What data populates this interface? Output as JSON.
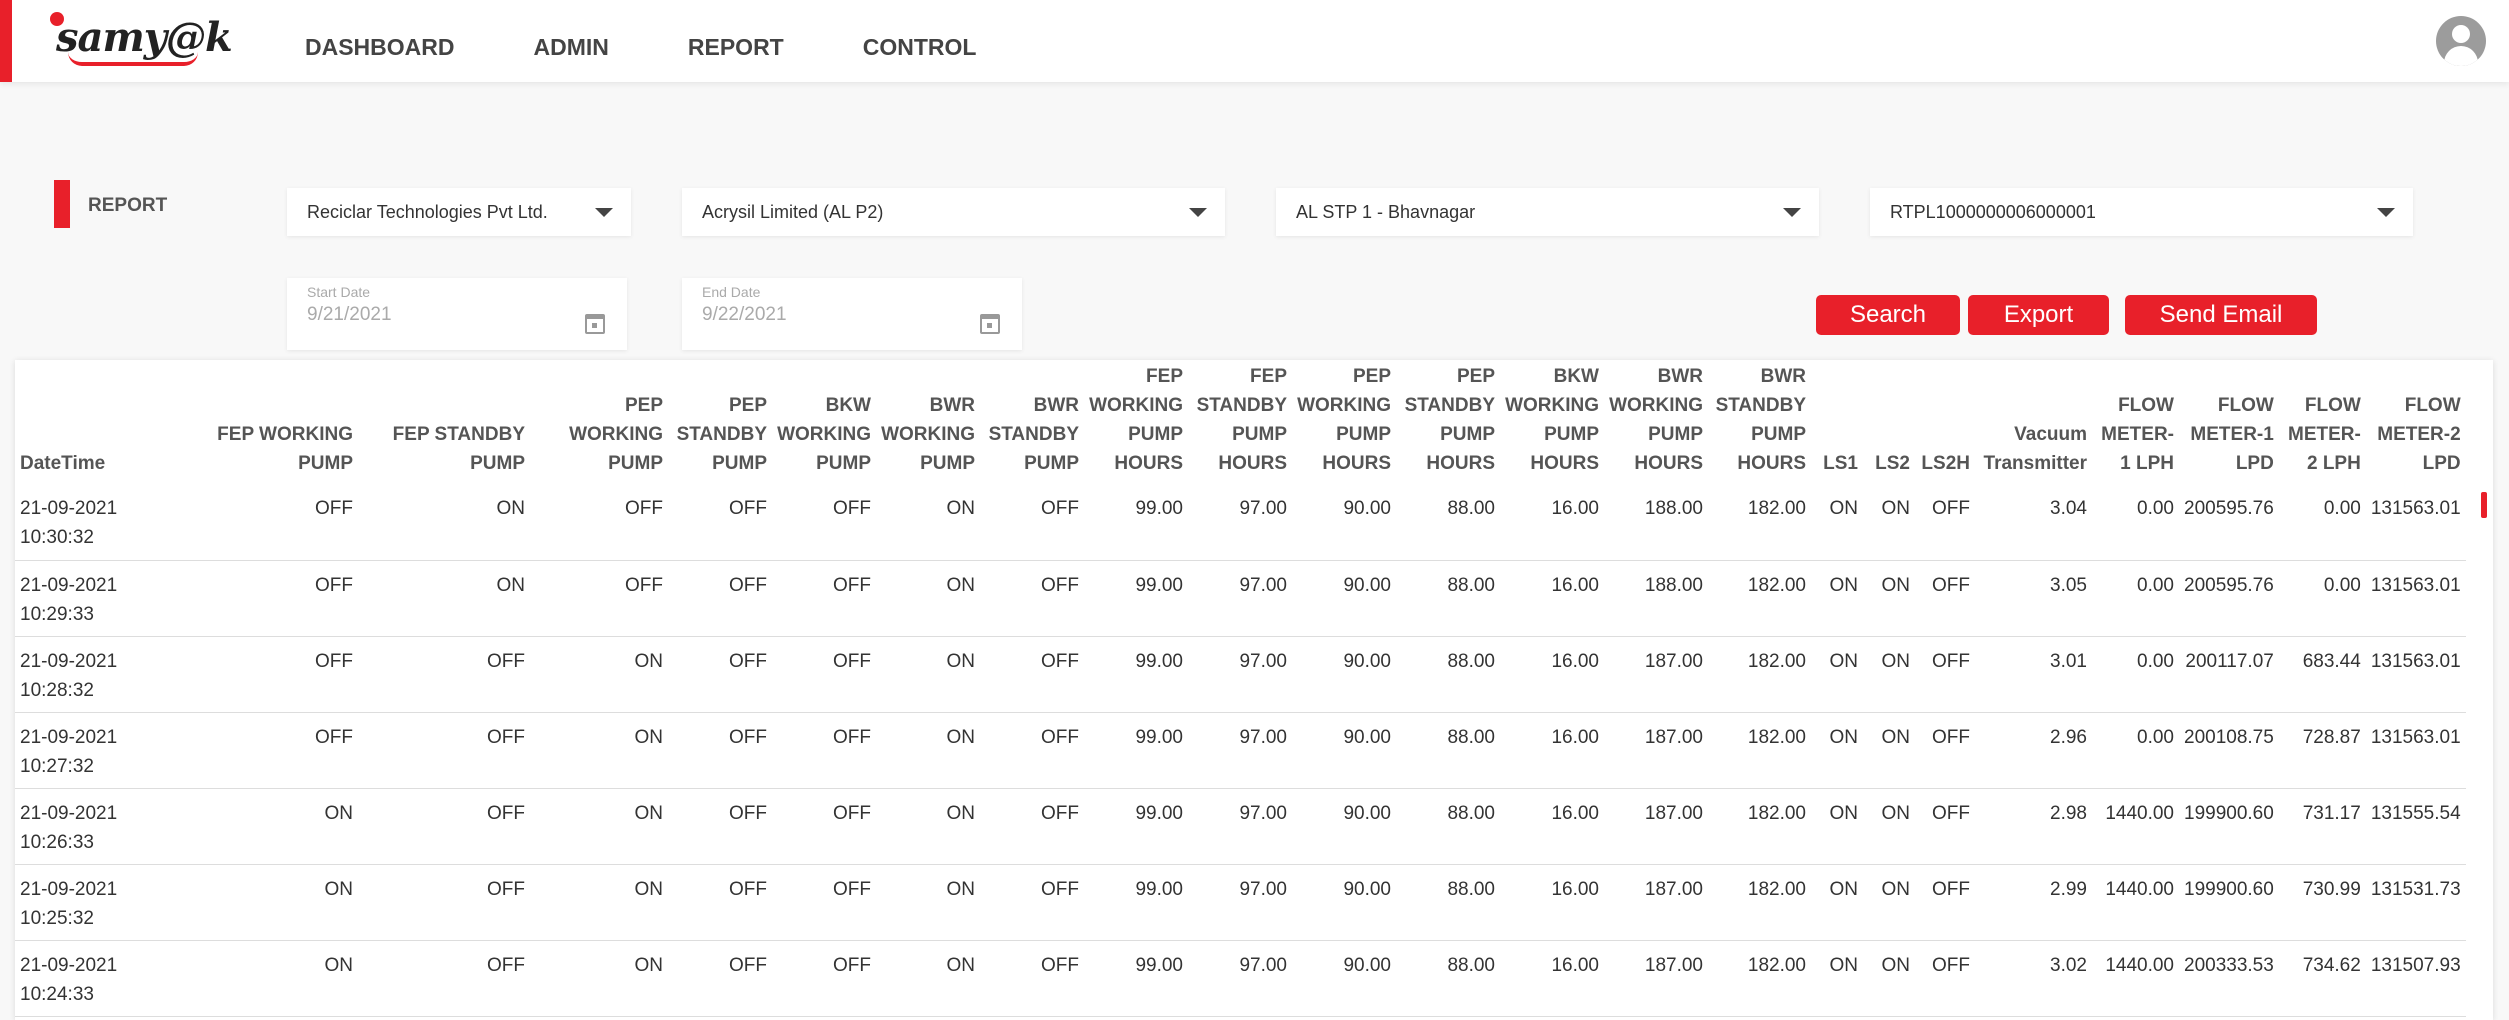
{
  "brand": {
    "logo_text": "samy@k"
  },
  "nav": [
    "DASHBOARD",
    "ADMIN",
    "REPORT",
    "CONTROL"
  ],
  "report": {
    "label": "REPORT",
    "filters": {
      "company": "Reciclar Technologies Pvt Ltd.",
      "client": "Acrysil Limited (AL P2)",
      "site": "AL STP 1 - Bhavnagar",
      "device": "RTPL1000000006000001"
    },
    "start_date": {
      "label": "Start Date",
      "value": "9/21/2021"
    },
    "end_date": {
      "label": "End Date",
      "value": "9/22/2021"
    },
    "buttons": {
      "search": "Search",
      "export": "Export",
      "email": "Send Email"
    }
  },
  "table": {
    "headers": [
      [
        "DateTime"
      ],
      [
        "FEP WORKING",
        "PUMP"
      ],
      [
        "FEP STANDBY",
        "PUMP"
      ],
      [
        "PEP",
        "WORKING",
        "PUMP"
      ],
      [
        "PEP",
        "STANDBY",
        "PUMP"
      ],
      [
        "BKW",
        "WORKING",
        "PUMP"
      ],
      [
        "BWR",
        "WORKING",
        "PUMP"
      ],
      [
        "BWR",
        "STANDBY",
        "PUMP"
      ],
      [
        "FEP",
        "WORKING",
        "PUMP",
        "HOURS"
      ],
      [
        "FEP",
        "STANDBY",
        "PUMP",
        "HOURS"
      ],
      [
        "PEP",
        "WORKING",
        "PUMP",
        "HOURS"
      ],
      [
        "PEP",
        "STANDBY",
        "PUMP",
        "HOURS"
      ],
      [
        "BKW",
        "WORKING",
        "PUMP",
        "HOURS"
      ],
      [
        "BWR",
        "WORKING",
        "PUMP",
        "HOURS"
      ],
      [
        "BWR",
        "STANDBY",
        "PUMP",
        "HOURS"
      ],
      [
        "LS1"
      ],
      [
        "LS2"
      ],
      [
        "LS2H"
      ],
      [
        "Vacuum",
        "Transmitter"
      ],
      [
        "FLOW",
        "METER-",
        "1 LPH"
      ],
      [
        "FLOW",
        "METER-1",
        "LPD"
      ],
      [
        "FLOW",
        "METER-",
        "2 LPH"
      ],
      [
        "FLOW",
        "METER-2",
        "LPD"
      ]
    ],
    "rows": [
      [
        "21-09-2021\n10:30:32",
        "OFF",
        "ON",
        "OFF",
        "OFF",
        "OFF",
        "ON",
        "OFF",
        "99.00",
        "97.00",
        "90.00",
        "88.00",
        "16.00",
        "188.00",
        "182.00",
        "ON",
        "ON",
        "OFF",
        "3.04",
        "0.00",
        "200595.76",
        "0.00",
        "131563.01"
      ],
      [
        "21-09-2021\n10:29:33",
        "OFF",
        "ON",
        "OFF",
        "OFF",
        "OFF",
        "ON",
        "OFF",
        "99.00",
        "97.00",
        "90.00",
        "88.00",
        "16.00",
        "188.00",
        "182.00",
        "ON",
        "ON",
        "OFF",
        "3.05",
        "0.00",
        "200595.76",
        "0.00",
        "131563.01"
      ],
      [
        "21-09-2021\n10:28:32",
        "OFF",
        "OFF",
        "ON",
        "OFF",
        "OFF",
        "ON",
        "OFF",
        "99.00",
        "97.00",
        "90.00",
        "88.00",
        "16.00",
        "187.00",
        "182.00",
        "ON",
        "ON",
        "OFF",
        "3.01",
        "0.00",
        "200117.07",
        "683.44",
        "131563.01"
      ],
      [
        "21-09-2021\n10:27:32",
        "OFF",
        "OFF",
        "ON",
        "OFF",
        "OFF",
        "ON",
        "OFF",
        "99.00",
        "97.00",
        "90.00",
        "88.00",
        "16.00",
        "187.00",
        "182.00",
        "ON",
        "ON",
        "OFF",
        "2.96",
        "0.00",
        "200108.75",
        "728.87",
        "131563.01"
      ],
      [
        "21-09-2021\n10:26:33",
        "ON",
        "OFF",
        "ON",
        "OFF",
        "OFF",
        "ON",
        "OFF",
        "99.00",
        "97.00",
        "90.00",
        "88.00",
        "16.00",
        "187.00",
        "182.00",
        "ON",
        "ON",
        "OFF",
        "2.98",
        "1440.00",
        "199900.60",
        "731.17",
        "131555.54"
      ],
      [
        "21-09-2021\n10:25:32",
        "ON",
        "OFF",
        "ON",
        "OFF",
        "OFF",
        "ON",
        "OFF",
        "99.00",
        "97.00",
        "90.00",
        "88.00",
        "16.00",
        "187.00",
        "182.00",
        "ON",
        "ON",
        "OFF",
        "2.99",
        "1440.00",
        "199900.60",
        "730.99",
        "131531.73"
      ],
      [
        "21-09-2021\n10:24:33",
        "ON",
        "OFF",
        "ON",
        "OFF",
        "OFF",
        "ON",
        "OFF",
        "99.00",
        "97.00",
        "90.00",
        "88.00",
        "16.00",
        "187.00",
        "182.00",
        "ON",
        "ON",
        "OFF",
        "3.02",
        "1440.00",
        "200333.53",
        "734.62",
        "131507.93"
      ]
    ]
  },
  "colors": {
    "accent": "#e8202a",
    "background": "#f8f8f8",
    "text": "#333333"
  }
}
